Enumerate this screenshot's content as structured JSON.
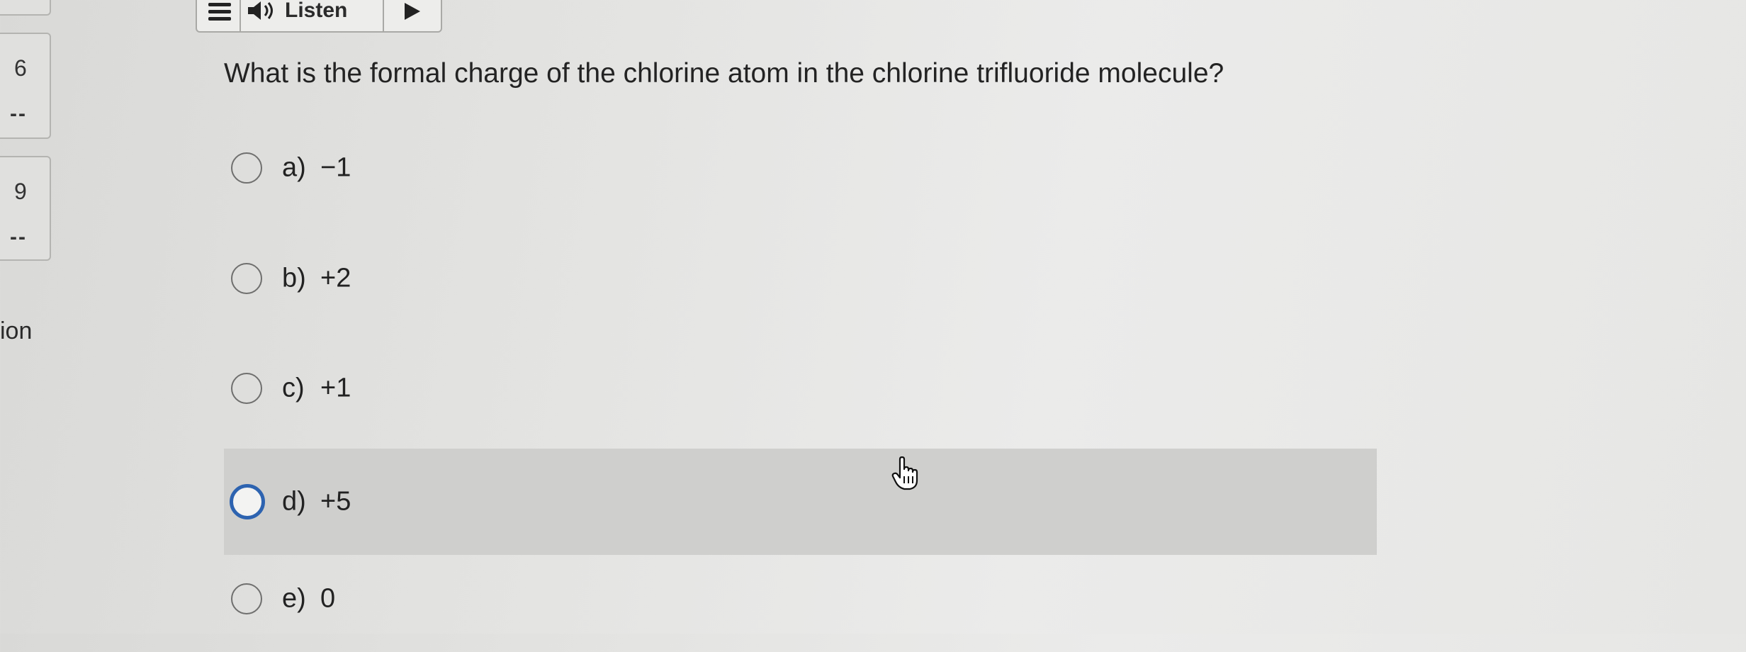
{
  "toolbar": {
    "listen_label": "Listen",
    "menu_icon": "hamburger-menu-icon",
    "speaker_icon": "speaker-icon",
    "play_icon": "play-icon"
  },
  "navigator": {
    "items": [
      {
        "number": "6",
        "status": "--"
      },
      {
        "number": "9",
        "status": "--"
      }
    ],
    "partial_label": "ion"
  },
  "question": {
    "text": "What is the formal charge of the chlorine atom in the chlorine trifluoride molecule?"
  },
  "options": [
    {
      "letter": "a)",
      "value": "−1",
      "selected": false
    },
    {
      "letter": "b)",
      "value": "+2",
      "selected": false
    },
    {
      "letter": "c)",
      "value": "+1",
      "selected": false
    },
    {
      "letter": "d)",
      "value": "+5",
      "selected": true
    },
    {
      "letter": "e)",
      "value": "0",
      "selected": false
    }
  ],
  "colors": {
    "background": "#e4e4e2",
    "selected_row": "#cfcfcd",
    "focus_ring": "#2d63b0"
  }
}
